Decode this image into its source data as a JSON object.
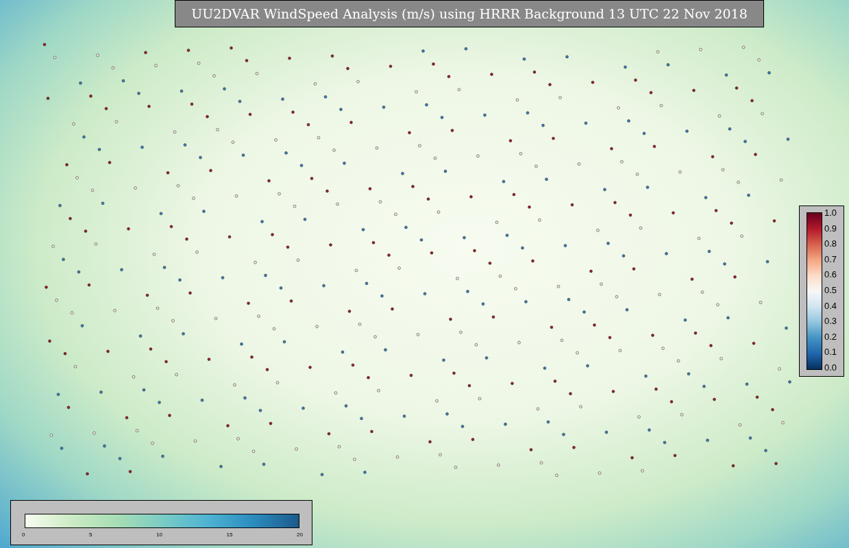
{
  "title": "UU2DVAR WindSpeed Analysis (m/s) using HRRR Background 13 UTC 22 Nov 2018",
  "ratio_colorbar": {
    "ticks": [
      "1.0",
      "0.9",
      "0.8",
      "0.7",
      "0.6",
      "0.5",
      "0.4",
      "0.3",
      "0.2",
      "0.1",
      "0.0"
    ]
  },
  "speed_colorbar": {
    "ticks": [
      "0",
      "5",
      "10",
      "15",
      "20"
    ]
  }
}
